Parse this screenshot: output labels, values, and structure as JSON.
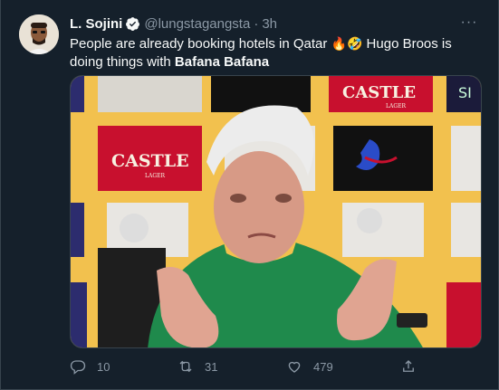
{
  "tweet": {
    "author_name": "L. Sojini",
    "handle": "@lungstagangsta",
    "separator": "·",
    "time": "3h",
    "more_glyph": "···",
    "text_part1": "People are already booking hotels in Qatar ",
    "emoji1": "🔥🤣",
    "text_part2": " Hugo Broos is doing things with ",
    "bold_text": "Bafana Bafana",
    "media_brands": [
      "CASTLE",
      "CASTLE",
      "SI",
      "LAGER",
      "LAGER"
    ],
    "actions": {
      "reply_count": "10",
      "retweet_count": "31",
      "like_count": "479"
    }
  },
  "colors": {
    "background": "#15202b",
    "verified_blue": "#1d9bf0",
    "muted_text": "#8b98a5",
    "border": "#38444d",
    "backdrop_yellow": "#f2c14e",
    "castle_red": "#c8102e",
    "jersey_green": "#1f8a4c"
  },
  "icons": [
    "verified-badge-icon",
    "more-options-icon",
    "reply-icon",
    "retweet-icon",
    "like-icon",
    "share-icon"
  ]
}
